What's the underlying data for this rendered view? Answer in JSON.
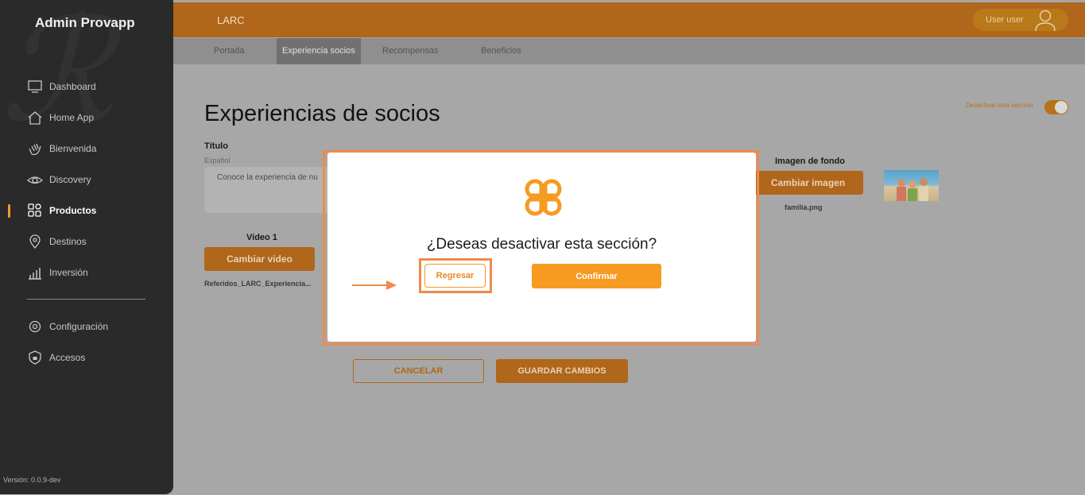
{
  "sidebar": {
    "brand": "Admin Provapp",
    "items": [
      {
        "label": "Dashboard",
        "icon": "monitor-icon"
      },
      {
        "label": "Home App",
        "icon": "home-icon"
      },
      {
        "label": "Bienvenida",
        "icon": "wave-hand-icon"
      },
      {
        "label": "Discovery",
        "icon": "eye-icon"
      },
      {
        "label": "Productos",
        "icon": "grid-icon"
      },
      {
        "label": "Destinos",
        "icon": "location-pin-icon"
      },
      {
        "label": "Inversión",
        "icon": "bar-chart-icon"
      },
      {
        "label": "Configuración",
        "icon": "gear-icon"
      },
      {
        "label": "Accesos",
        "icon": "lock-shield-icon"
      }
    ],
    "active_item": "Productos",
    "version": "Versión: 0.0.9-dev"
  },
  "header": {
    "app_name": "LARC",
    "user_label": "User user"
  },
  "tabs": [
    "Portada",
    "Experiencia socios",
    "Recompensas",
    "Beneficios"
  ],
  "active_tab": "Experiencia socios",
  "main": {
    "title": "Experiencias de socios",
    "toggle_label": "Desactivar esta sección",
    "toggle_on": true,
    "titulo_label": "Título",
    "language_label": "Español",
    "titulo_value": "Conoce la experiencia de nu",
    "video_label": "Video 1",
    "change_video_label": "Cambiar video",
    "video_file": "Referidos_LARC_Experiencia...",
    "background_label": "Imagen de fondo",
    "change_image_label": "Cambiar imagen",
    "image_file": "familia.png",
    "cancel_label": "CANCELAR",
    "save_label": "GUARDAR CAMBIOS"
  },
  "modal": {
    "question": "¿Deseas desactivar esta sección?",
    "back_label": "Regresar",
    "confirm_label": "Confirmar"
  },
  "colors": {
    "accent": "#f69a22",
    "header_dimmed": "#b0661b",
    "sidebar_bg": "#2a2a2a",
    "highlight": "#f08a4b"
  }
}
